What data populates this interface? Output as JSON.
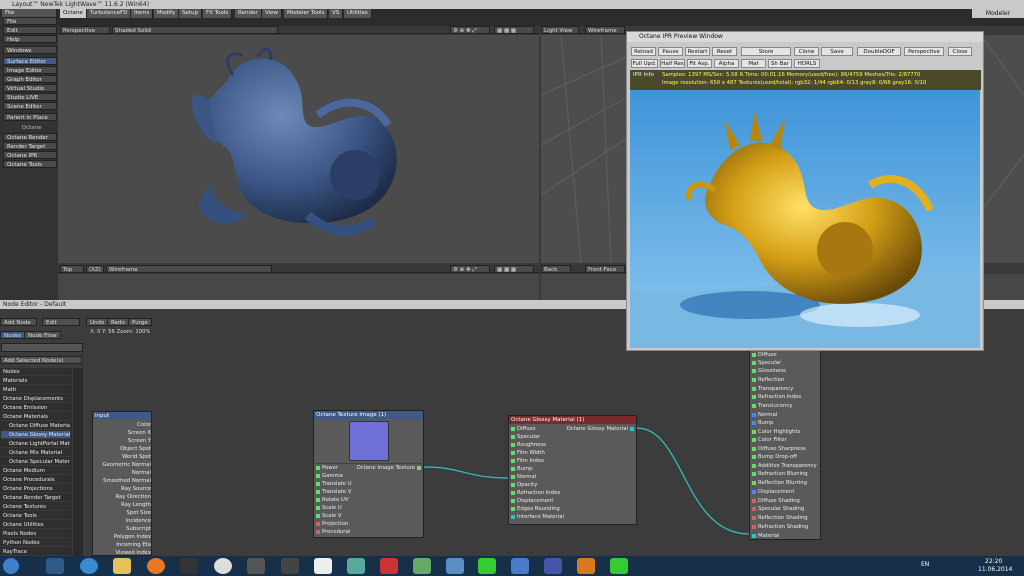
{
  "window_title": "Layout™ NewTek LightWave™ 11.6.2 (Win64)",
  "menu_tabs": [
    "File",
    "Octane",
    "TurbulenceFD",
    "Items",
    "Modify",
    "Setup",
    "FX Tools",
    "Render",
    "View",
    "Modeler Tools",
    "VS",
    "Utilities"
  ],
  "layout_label": "Modeler",
  "left_panel": {
    "buttons": [
      "File",
      "Edit",
      "Help",
      "Windows",
      "Surface Editor",
      "Image Editor",
      "Graph Editor",
      "Virtual Studio",
      "Studio LIVE",
      "Scene Editor",
      "Parent in Place"
    ],
    "section_label": "Octane",
    "octane_buttons": [
      "Octane Render",
      "Render Target",
      "Octane IPR",
      "Octane Tools"
    ]
  },
  "viewport_top_left": {
    "view": "Perspective",
    "shading": "Shaded Solid"
  },
  "viewport_top_right": {
    "view": "Light View",
    "shading": "Wireframe"
  },
  "viewport_bottom_left": {
    "view": "Top",
    "axis": "(XZ)",
    "shading": "Wireframe"
  },
  "viewport_bottom_right": {
    "view": "Back",
    "shading": "Front Face"
  },
  "node_editor": {
    "title": "Node Editor - Default",
    "add_node": "Add Node",
    "edit": "Edit",
    "undo": "Undo",
    "redo": "Redo",
    "purge": "Purge",
    "coords": "X: 0  Y: 56  Zoom: 100%",
    "tabs": [
      "Nodes",
      "Node Flow"
    ],
    "add_selected": "Add Selected Node(s)",
    "tree": [
      "Nodes",
      "Materials",
      "Math",
      "Octane Displacements",
      "Octane Emission",
      "Octane Materials",
      "Octane Diffuse Material",
      "Octane Glossy Material",
      "Octane LightPortal Material",
      "Octane Mix Material",
      "Octane Specular Material",
      "Octane Medium",
      "Octane Procedurals",
      "Octane Projections",
      "Octane Render Target",
      "Octane Textures",
      "Octane Tools",
      "Octane Utilities",
      "Pixels Nodes",
      "Python Nodes",
      "RayTrace",
      "Pinnen Collect"
    ]
  },
  "nodes": {
    "input": {
      "title": "Input",
      "ports": [
        "Color",
        "Screen X",
        "Screen Y",
        "Object Spot",
        "World Spot",
        "Geometric Normal",
        "Normal",
        "Smoothed Normal",
        "Ray Source",
        "Ray Direction",
        "Ray Length",
        "Spot Size",
        "Incidence",
        "Subscript",
        "Polygon Index",
        "Incoming Eta",
        "Viewed Index"
      ]
    },
    "texture": {
      "title": "Octane Texture Image (1)",
      "ports": [
        "Power",
        "Gamma",
        "Translate U",
        "Translate V",
        "Rotate UV",
        "Scale U",
        "Scale V",
        "Projection",
        "Procedural"
      ],
      "output": "Octane Image Texture"
    },
    "glossy": {
      "title": "Octane Glossy Material (1)",
      "ports": [
        "Diffuse",
        "Specular",
        "Roughness",
        "Film Width",
        "Film Index",
        "Bump",
        "Normal",
        "Opacity",
        "Refraction Index",
        "Displacement",
        "Edges Rounding",
        "Interface Material"
      ],
      "output": "Octane Glossy Material"
    },
    "surface": {
      "ports": [
        "Diffuse",
        "Specular",
        "Glossiness",
        "Reflection",
        "Transparency",
        "Refraction Index",
        "Translucency",
        "Normal",
        "Bump",
        "Color Highlights",
        "Color Filter",
        "Diffuse Sharpness",
        "Bump Drop-off",
        "Additive Transparency",
        "Refraction Blurring",
        "Reflection Blurring",
        "Displacement",
        "Diffuse Shading",
        "Specular Shading",
        "Reflection Shading",
        "Refraction Shading",
        "Material"
      ]
    }
  },
  "octane_window": {
    "title": "Octane IPR Preview Window",
    "row1": [
      "Reload",
      "Pause",
      "Restart",
      "Reset",
      "Store",
      "Clone",
      "Save",
      "DoubleDOF",
      "Perspective",
      "Close"
    ],
    "row2": [
      "Full Upd.",
      "Half Res",
      "Fit Asp.",
      "Alpha",
      "Mat Upd",
      "Sh Bar",
      "HDRLS"
    ],
    "ipr_label": "IPR Info",
    "stats1": "Samples: 1397    MS/Sec: 5.58    R.Time: 00:01:16    Memory(used/free): 86/4759    Meshes/Tris: 2/87770",
    "stats2": "Image resolution: 650 x 487    Textures(used/total): rgb32: 1/44  rgb64: 0/13  gray8: 0/68  gray16: 0/10"
  },
  "taskbar": {
    "lang": "EN",
    "time": "22:20",
    "date": "11.06.2014"
  },
  "colors": {
    "accent_blue": "#3f5a86",
    "gold": "#d4a017",
    "sky": "#5ba8e0"
  }
}
